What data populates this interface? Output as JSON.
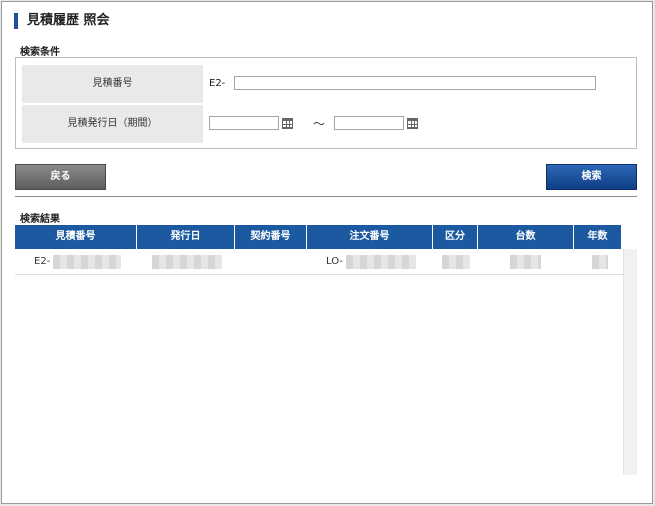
{
  "page_title": "見積履歴 照会",
  "search_section": {
    "heading": "検索条件",
    "estimate_number_label": "見積番号",
    "estimate_prefix": "E2-",
    "estimate_number_value": "",
    "issue_date_label": "見積発行日（期間）",
    "date_from_value": "",
    "date_to_value": "",
    "range_separator": "〜"
  },
  "buttons": {
    "back": "戻る",
    "search": "検索"
  },
  "results_section": {
    "heading": "検索結果",
    "columns": [
      "見積番号",
      "発行日",
      "契約番号",
      "注文番号",
      "区分",
      "台数",
      "年数"
    ],
    "rows": [
      {
        "estimate_prefix": "E2-",
        "order_prefix": "LO-"
      }
    ]
  },
  "icons": [
    "calendar-icon"
  ],
  "colors": {
    "accent": "#1f4f9c",
    "header_bg": "#1b5aa0",
    "search_button": "#0e3f86",
    "back_button": "#6e6e6e"
  }
}
